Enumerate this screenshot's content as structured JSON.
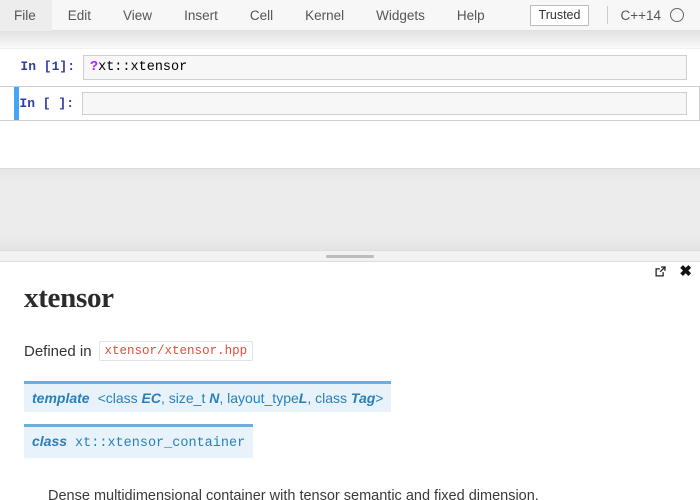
{
  "menubar": {
    "items": [
      {
        "label": "File"
      },
      {
        "label": "Edit"
      },
      {
        "label": "View"
      },
      {
        "label": "Insert"
      },
      {
        "label": "Cell"
      },
      {
        "label": "Kernel"
      },
      {
        "label": "Widgets"
      },
      {
        "label": "Help"
      }
    ],
    "trusted_label": "Trusted",
    "kernel_name": "C++14",
    "kernel_status_icon": "circle-idle-icon"
  },
  "notebook": {
    "cells": [
      {
        "prompt": "In [1]:",
        "code_operator": "?",
        "code_text": "xt::xtensor",
        "selected": false
      },
      {
        "prompt": "In [ ]:",
        "code_operator": "",
        "code_text": "",
        "selected": true
      }
    ]
  },
  "splitter": {
    "grip_icon": "drag-handle-icon"
  },
  "pager": {
    "controls": {
      "popout_icon": "pop-out-icon",
      "close_icon": "close-icon"
    },
    "title": "xtensor",
    "defined_label": "Defined in",
    "defined_file": "xtensor/xtensor.hpp",
    "signatures": [
      {
        "keyword": "template",
        "open": "<class ",
        "param1": "EC",
        "mid1": ", size_t ",
        "param2": "N",
        "mid2": ", layout_type",
        "param3": "L",
        "mid3": ", class ",
        "param4": "Tag",
        "close": ">"
      },
      {
        "keyword": "class",
        "name": "xt::xtensor_container"
      }
    ],
    "description": "Dense multidimensional container with tensor semantic and fixed dimension."
  },
  "colors": {
    "accent_blue": "#42a5f5",
    "prompt_blue": "#303f9f",
    "sig_bg": "#e7f2fa",
    "sig_border": "#6ab0de",
    "sig_text": "#2980b9",
    "code_red": "#e74c3c",
    "operator_purple": "#aa22ff"
  }
}
